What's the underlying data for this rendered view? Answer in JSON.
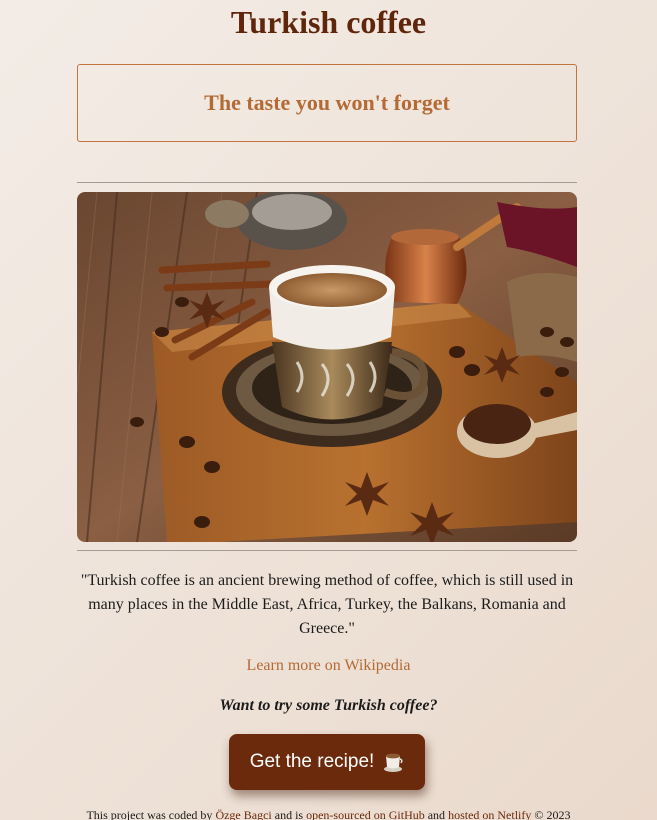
{
  "header": {
    "title": "Turkish coffee"
  },
  "tagline": {
    "text": "The taste you won't forget"
  },
  "hero_image": {
    "subject": "turkish-coffee-cup-photo"
  },
  "content": {
    "quote": "\"Turkish coffee is an ancient brewing method of coffee, which is still used in many places in the Middle East, Africa, Turkey, the Balkans, Romania and Greece.\"",
    "wiki_link": "Learn more on Wikipedia",
    "cta_question": "Want to try some Turkish coffee?",
    "cta_button": "Get the recipe!"
  },
  "footer": {
    "text_1": "This project was coded by ",
    "author_link": "Özge Bagci",
    "text_2": " and is ",
    "github_link": "open-sourced on GitHub",
    "text_3": " and ",
    "netlify_link": "hosted on Netlify",
    "text_4": " © 2023"
  },
  "colors": {
    "title": "#5f260c",
    "accent": "#b36a35",
    "button_bg": "#6b2a0b",
    "button_text": "#ffffff"
  }
}
